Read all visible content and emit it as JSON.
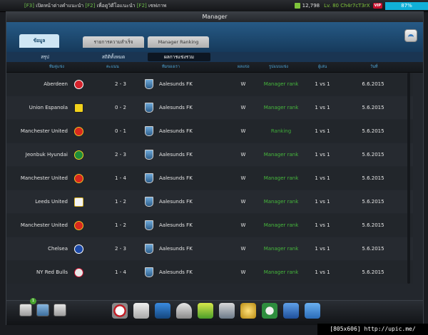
{
  "status_bar": {
    "hotkey": "[F3]",
    "left_text": "เปิดหน้าต่างคำแนะนำ",
    "hotkey2": "[F2]",
    "left_text2": "เพื่อดูวิดีโอแนะนำ",
    "hotkey3": "[F2]",
    "left_text3": "เซฟภาพ",
    "money": "12,798",
    "level": "Lv. 80 Ch4r7cT3rX",
    "vip": "VIP",
    "battery": "87%"
  },
  "window": {
    "title": "Manager",
    "tabs": [
      "ข้อมูล",
      "รายการความสำเร็จ",
      "Manager Ranking"
    ],
    "subtabs": [
      "สรุป",
      "สถิติทั้งหมด",
      "ผลการแข่งรวม"
    ]
  },
  "columns": [
    "ทีมคู่แข่ง",
    "คะแนน",
    "ทีมของเรา",
    "ผลแข่ง",
    "รูปแบบแข่ง",
    "ผู้เล่น",
    "วันที่"
  ],
  "matches": [
    {
      "opponent": "Aberdeen",
      "score": "2 - 3",
      "our_team": "Aalesunds FK",
      "result": "W",
      "type": "Manager rank",
      "format": "1 vs 1",
      "date": "6.6.2015"
    },
    {
      "opponent": "Union Espanola",
      "score": "0 - 2",
      "our_team": "Aalesunds FK",
      "result": "W",
      "type": "Manager rank",
      "format": "1 vs 1",
      "date": "5.6.2015"
    },
    {
      "opponent": "Manchester United",
      "score": "0 - 1",
      "our_team": "Aalesunds FK",
      "result": "W",
      "type": "Ranking",
      "format": "1 vs 1",
      "date": "5.6.2015"
    },
    {
      "opponent": "Jeonbuk Hyundai",
      "score": "2 - 3",
      "our_team": "Aalesunds FK",
      "result": "W",
      "type": "Manager rank",
      "format": "1 vs 1",
      "date": "5.6.2015"
    },
    {
      "opponent": "Manchester United",
      "score": "1 - 4",
      "our_team": "Aalesunds FK",
      "result": "W",
      "type": "Manager rank",
      "format": "1 vs 1",
      "date": "5.6.2015"
    },
    {
      "opponent": "Leeds United",
      "score": "1 - 2",
      "our_team": "Aalesunds FK",
      "result": "W",
      "type": "Manager rank",
      "format": "1 vs 1",
      "date": "5.6.2015"
    },
    {
      "opponent": "Manchester United",
      "score": "1 - 2",
      "our_team": "Aalesunds FK",
      "result": "W",
      "type": "Manager rank",
      "format": "1 vs 1",
      "date": "5.6.2015"
    },
    {
      "opponent": "Chelsea",
      "score": "2 - 3",
      "our_team": "Aalesunds FK",
      "result": "W",
      "type": "Manager rank",
      "format": "1 vs 1",
      "date": "5.6.2015"
    },
    {
      "opponent": "NY Red Bulls",
      "score": "1 - 4",
      "our_team": "Aalesunds FK",
      "result": "W",
      "type": "Manager rank",
      "format": "1 vs 1",
      "date": "5.6.2015"
    }
  ],
  "dock": {
    "notification_count": "1",
    "icons": [
      "ball-icon",
      "kit-icon",
      "boot-icon",
      "trophy-icon",
      "cone-icon",
      "card-pack-icon",
      "coin-icon",
      "league-badge-icon",
      "stats-icon",
      "basket-icon"
    ]
  },
  "watermark": "[805x606] http://upic.me/",
  "colors": {
    "accent_blue": "#265a86",
    "manager_rank_green": "#46b83c",
    "header_text_blue": "#4fa6d8"
  }
}
